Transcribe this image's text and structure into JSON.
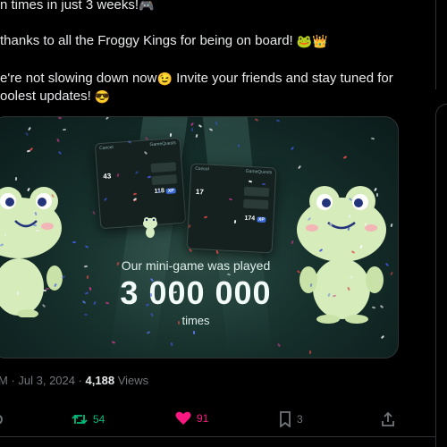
{
  "tweet": {
    "lines": [
      "n times in just 3 weeks!",
      " thanks to all the Froggy Kings for being on board! ",
      "e're not slowing down now",
      "oolest updates! "
    ],
    "line3_tail": " Invite your friends and stay tuned for",
    "emojis": {
      "gamepad": "🎮",
      "frog": "🐸",
      "crown": "👑",
      "wink": "😉",
      "sunglasses": "😎"
    }
  },
  "media": {
    "caption_top": "Our mini-game was played",
    "caption_number": "3 000 000",
    "caption_bottom": "times",
    "phone_left": {
      "cancel": "Cancel",
      "title": "GameQuests",
      "score": "43",
      "pill": "118",
      "badge": "XP"
    },
    "phone_right": {
      "cancel": "Cancel",
      "title": "GameQuests",
      "score": "17",
      "pill": "174",
      "badge": "XP"
    }
  },
  "meta": {
    "time_prefix": "M · Jul 3, 2024 · ",
    "views_count": "4,188",
    "views_label": " Views"
  },
  "actions": {
    "retweets": "54",
    "likes": "91",
    "bookmarks": "3"
  },
  "colors": {
    "background": "#000000",
    "text": "#e7e9ea",
    "muted": "#71767b",
    "retweet_green": "#00ba7c",
    "like_pink": "#f91880"
  }
}
